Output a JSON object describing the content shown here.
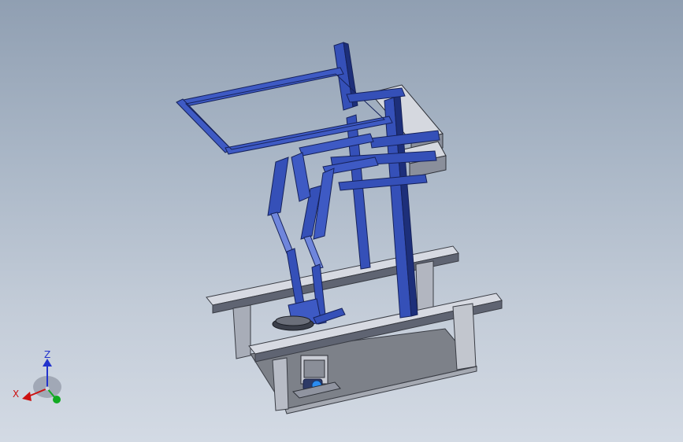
{
  "triad": {
    "z_label": "Z",
    "x_label": "X",
    "y_label": "",
    "colors": {
      "z": "#2233cc",
      "x": "#cc1111",
      "y": "#11aa22"
    }
  },
  "colors": {
    "frame_blue": "#3550b8",
    "frame_blue_light": "#6f86dc",
    "frame_blue_dark": "#1d2f7a",
    "base_gray": "#9aa0ac",
    "base_gray_light": "#cfd2da",
    "base_gray_dark": "#5d6270",
    "floor_gray": "#7c8088"
  }
}
